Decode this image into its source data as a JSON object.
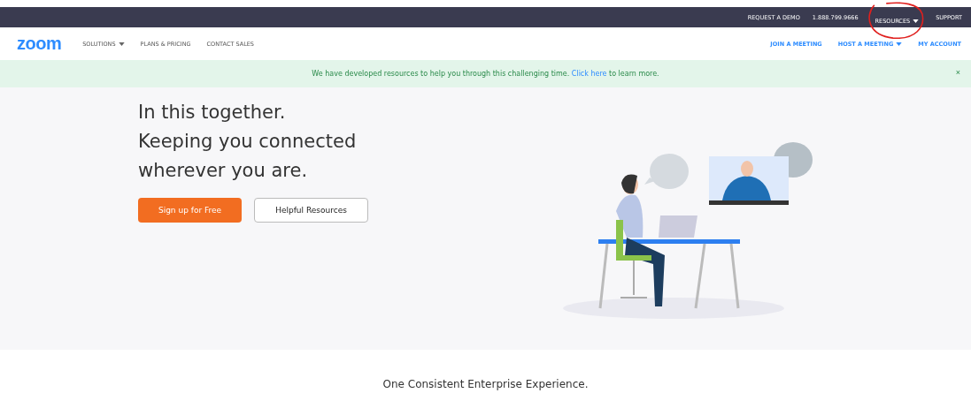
{
  "top_bar": {
    "links": [
      {
        "label": "REQUEST A DEMO",
        "dropdown": false,
        "circled": false
      },
      {
        "label": "1.888.799.9666",
        "dropdown": false,
        "circled": false
      },
      {
        "label": "RESOURCES",
        "dropdown": true,
        "circled": true
      },
      {
        "label": "SUPPORT",
        "dropdown": false,
        "circled": false
      }
    ]
  },
  "nav": {
    "logo": "zoom",
    "left_links": [
      {
        "label": "SOLUTIONS",
        "dropdown": true
      },
      {
        "label": "PLANS & PRICING",
        "dropdown": false
      },
      {
        "label": "CONTACT SALES",
        "dropdown": false
      }
    ],
    "right_links": [
      {
        "label": "JOIN A MEETING",
        "dropdown": false
      },
      {
        "label": "HOST A MEETING",
        "dropdown": true
      },
      {
        "label": "MY ACCOUNT",
        "dropdown": false
      }
    ]
  },
  "banner": {
    "text_before": "We have developed resources to help you through this challenging time.",
    "link": "Click here",
    "text_after": "to learn more.",
    "close": "×"
  },
  "hero": {
    "headline": [
      "In this together.",
      "Keeping you connected",
      "wherever you are."
    ],
    "buttons": [
      {
        "label": "Sign up for Free",
        "kind": "primary"
      },
      {
        "label": "Helpful Resources",
        "kind": "outline"
      }
    ]
  },
  "section_title": "One Consistent Enterprise Experience."
}
